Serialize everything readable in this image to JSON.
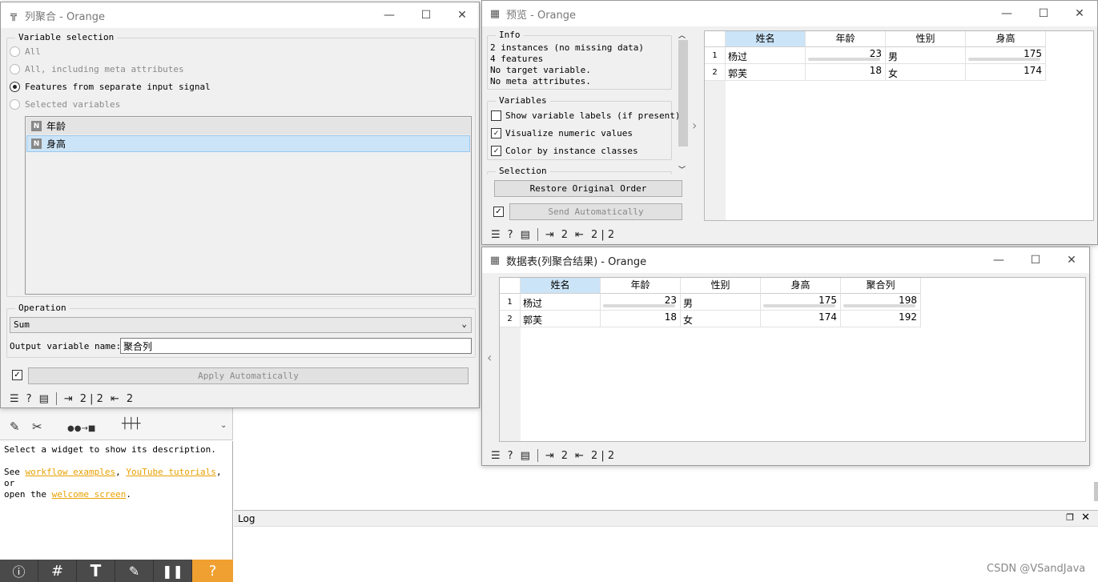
{
  "win1": {
    "title": "列聚合 - Orange",
    "group_var": "Variable selection",
    "radios": [
      "All",
      "All, including meta attributes",
      "Features from separate input signal",
      "Selected variables"
    ],
    "list": [
      {
        "badge": "N",
        "label": "年龄"
      },
      {
        "badge": "N",
        "label": "身高"
      }
    ],
    "group_op": "Operation",
    "op_value": "Sum",
    "out_label": "Output variable name:",
    "out_value": "聚合列",
    "apply": "Apply Automatically",
    "status_in": "2 | 2",
    "status_out": "2"
  },
  "canvas": {
    "desc1": "Select a widget to show its description.",
    "desc2a": "See ",
    "link1": "workflow examples",
    "sep1": ", ",
    "link2": "YouTube tutorials",
    "desc2b": ", or",
    "desc3a": "open the ",
    "link3": "welcome screen",
    "desc3b": ".",
    "log": "Log",
    "watermark": "CSDN @VSandJava",
    "toolbar_icons": [
      "info-icon",
      "grid-icon",
      "text-icon",
      "pen-icon",
      "pause-icon",
      "help-icon"
    ]
  },
  "win2": {
    "title": "预览 - Orange",
    "info_title": "Info",
    "info": [
      "2 instances (no missing data)",
      "4  features",
      "No target variable.",
      "No meta attributes."
    ],
    "vars_title": "Variables",
    "checks": [
      "Show variable labels (if present)",
      "Visualize numeric values",
      "Color by instance classes"
    ],
    "checks_state": [
      false,
      true,
      true
    ],
    "sel_title": "Selection",
    "restore": "Restore Original Order",
    "send": "Send Automatically",
    "status_in": "2",
    "status_out": "2 | 2",
    "columns": [
      "姓名",
      "年龄",
      "性别",
      "身高"
    ],
    "rows": [
      [
        "1",
        "杨过",
        "23",
        "男",
        "175"
      ],
      [
        "2",
        "郭芙",
        "18",
        "女",
        "174"
      ]
    ]
  },
  "win3": {
    "title": "数据表(列聚合结果) - Orange",
    "status_in": "2",
    "status_out": "2 | 2",
    "columns": [
      "姓名",
      "年龄",
      "性别",
      "身高",
      "聚合列"
    ],
    "rows": [
      [
        "1",
        "杨过",
        "23",
        "男",
        "175",
        "198"
      ],
      [
        "2",
        "郭芙",
        "18",
        "女",
        "174",
        "192"
      ]
    ]
  },
  "colors": {
    "selection": "#cce4f7",
    "accent": "#f0a030",
    "link": "#e8a000"
  }
}
